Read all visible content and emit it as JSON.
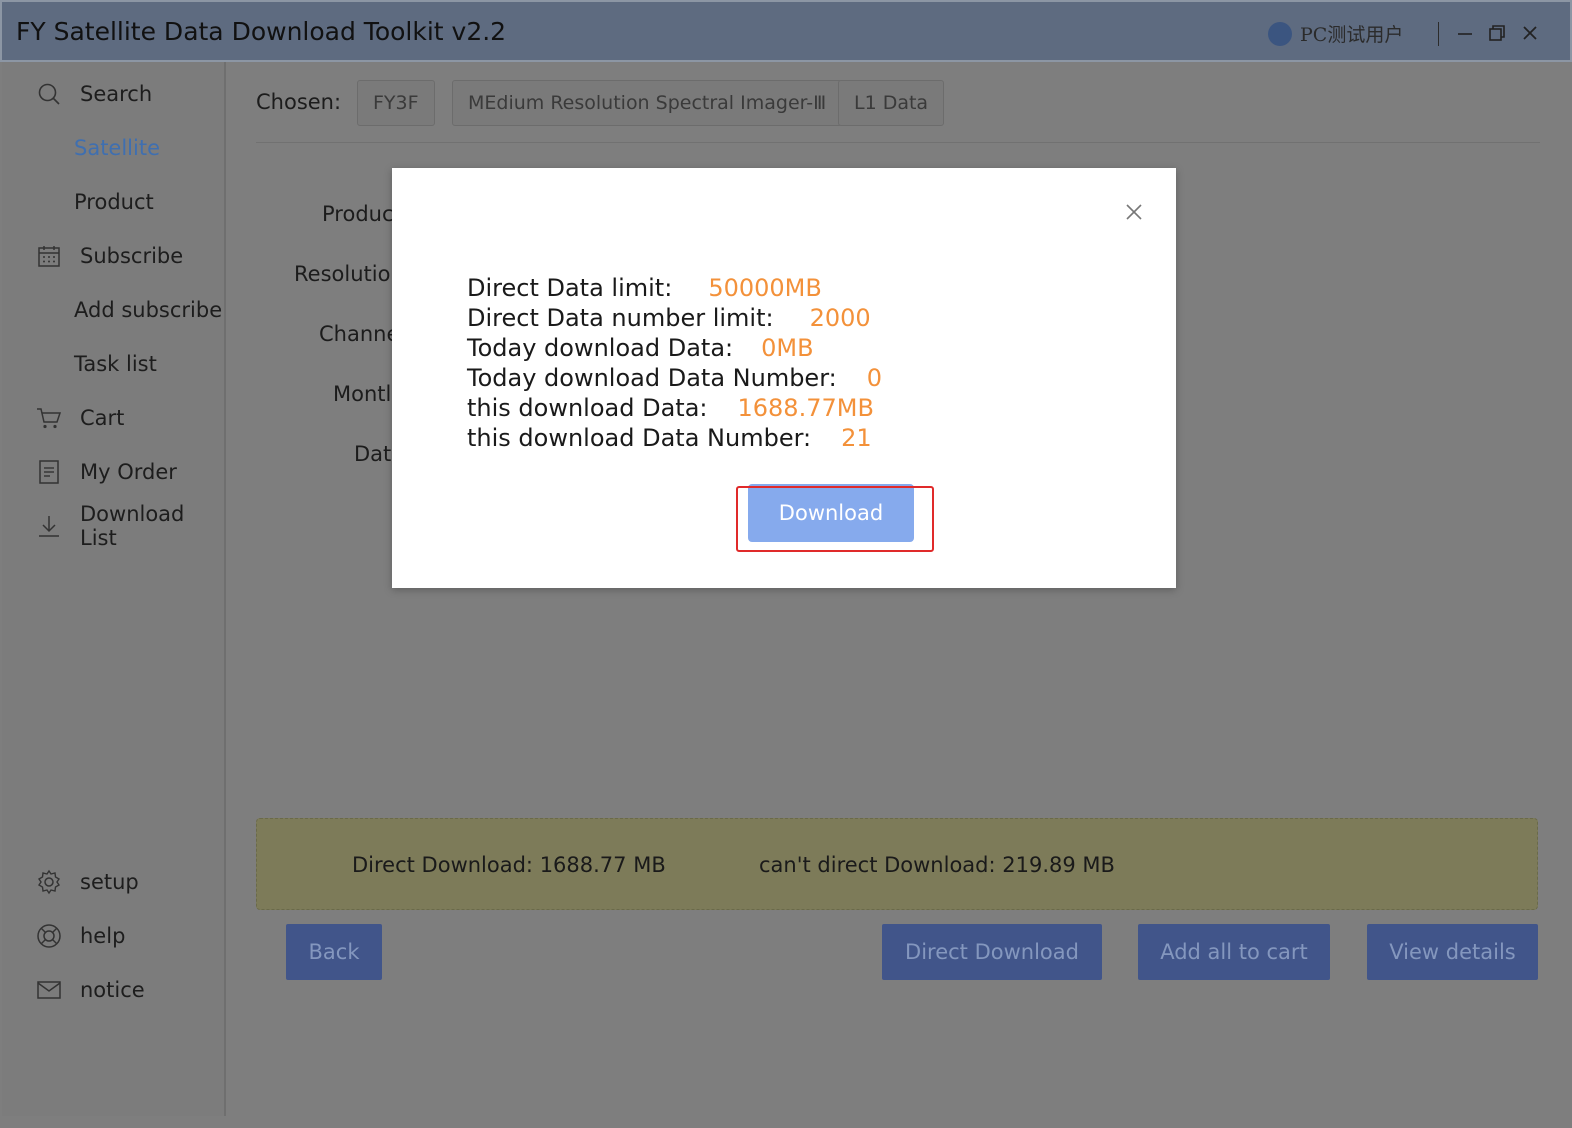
{
  "window": {
    "title": "FY Satellite Data Download Toolkit v2.2",
    "user": "PC测试用户",
    "controls": {
      "minimize": "—",
      "maximize": "❐",
      "close": "✕"
    }
  },
  "sidebar": {
    "items": [
      {
        "label": "Search",
        "icon": "search-icon"
      },
      {
        "label": "Satellite",
        "active": true
      },
      {
        "label": "Product"
      },
      {
        "label": "Subscribe",
        "icon": "calendar-icon"
      },
      {
        "label": "Add subscribe"
      },
      {
        "label": "Task list"
      },
      {
        "label": "Cart",
        "icon": "cart-icon"
      },
      {
        "label": "My Order",
        "icon": "document-icon"
      },
      {
        "label": "Download List",
        "icon": "download-icon"
      }
    ],
    "bottom": [
      {
        "label": "setup",
        "icon": "gear-icon"
      },
      {
        "label": "help",
        "icon": "lifebuoy-icon"
      },
      {
        "label": "notice",
        "icon": "mail-icon"
      }
    ]
  },
  "chosen": {
    "label": "Chosen:",
    "chips": [
      "FY3F",
      "MEdium Resolution Spectral Imager-Ⅲ",
      "L1 Data"
    ]
  },
  "form_labels": [
    "Produc",
    "Resolution",
    "Channe",
    "Montl",
    "Date"
  ],
  "summary": {
    "direct": "Direct Download: 1688.77 MB",
    "indirect": "can't direct Download: 219.89 MB"
  },
  "buttons": {
    "back": "Back",
    "direct_download": "Direct Download",
    "add_all": "Add all to cart",
    "view_details": "View details"
  },
  "modal": {
    "rows": [
      {
        "label": "Direct Data limit:",
        "value": "50000MB"
      },
      {
        "label": "Direct Data number limit:",
        "value": "2000"
      },
      {
        "label": "Today download Data:",
        "value": "0MB"
      },
      {
        "label": "Today download Data Number:",
        "value": "0"
      },
      {
        "label": "this download Data:",
        "value": "1688.77MB"
      },
      {
        "label": "this download Data Number:",
        "value": "21"
      }
    ],
    "download_label": "Download"
  },
  "colors": {
    "accent": "#3f6fb0",
    "value_orange": "#f3913a",
    "modal_button": "#86aaed",
    "highlight_red": "#e02a2a"
  }
}
